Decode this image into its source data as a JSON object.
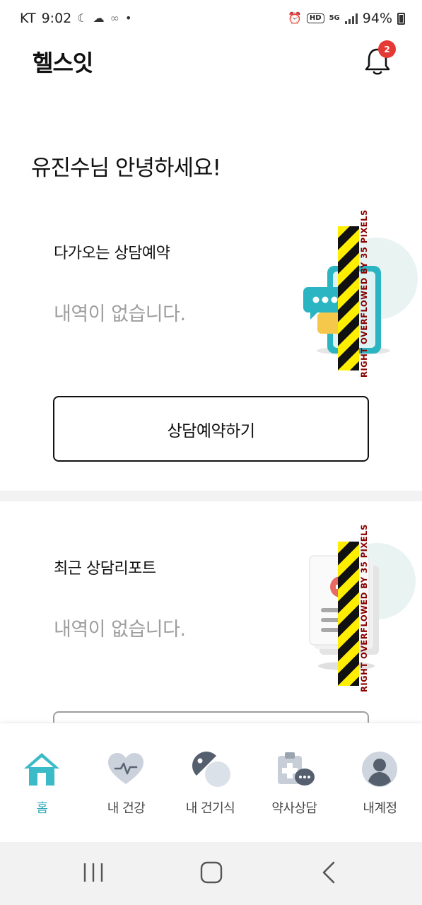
{
  "status_bar": {
    "carrier": "KT",
    "time": "9:02",
    "network": "5G",
    "hd": "HD",
    "battery": "94%"
  },
  "app_bar": {
    "title": "헬스잇",
    "notification_count": "2"
  },
  "greeting": "유진수님 안녕하세요!",
  "upcoming_card": {
    "title": "다가오는 상담예약",
    "empty_text": "내역이 없습니다.",
    "button_label": "상담예약하기",
    "overflow_warning": "RIGHT OVERFLOWED BY 35 PIXELS"
  },
  "report_card": {
    "title": "최근 상담리포트",
    "empty_text": "내역이 없습니다.",
    "overflow_warning": "RIGHT OVERFLOWED BY 35 PIXELS"
  },
  "bottom_nav": {
    "items": [
      {
        "label": "홈",
        "icon": "home-icon",
        "active": true
      },
      {
        "label": "내 건강",
        "icon": "heart-pulse-icon",
        "active": false
      },
      {
        "label": "내 건기식",
        "icon": "pill-icon",
        "active": false
      },
      {
        "label": "약사상담",
        "icon": "medical-chat-icon",
        "active": false
      },
      {
        "label": "내계정",
        "icon": "user-icon",
        "active": false
      }
    ]
  },
  "colors": {
    "accent": "#2ea9b9",
    "badge": "#e53935",
    "muted_text": "#9e9e9e"
  }
}
